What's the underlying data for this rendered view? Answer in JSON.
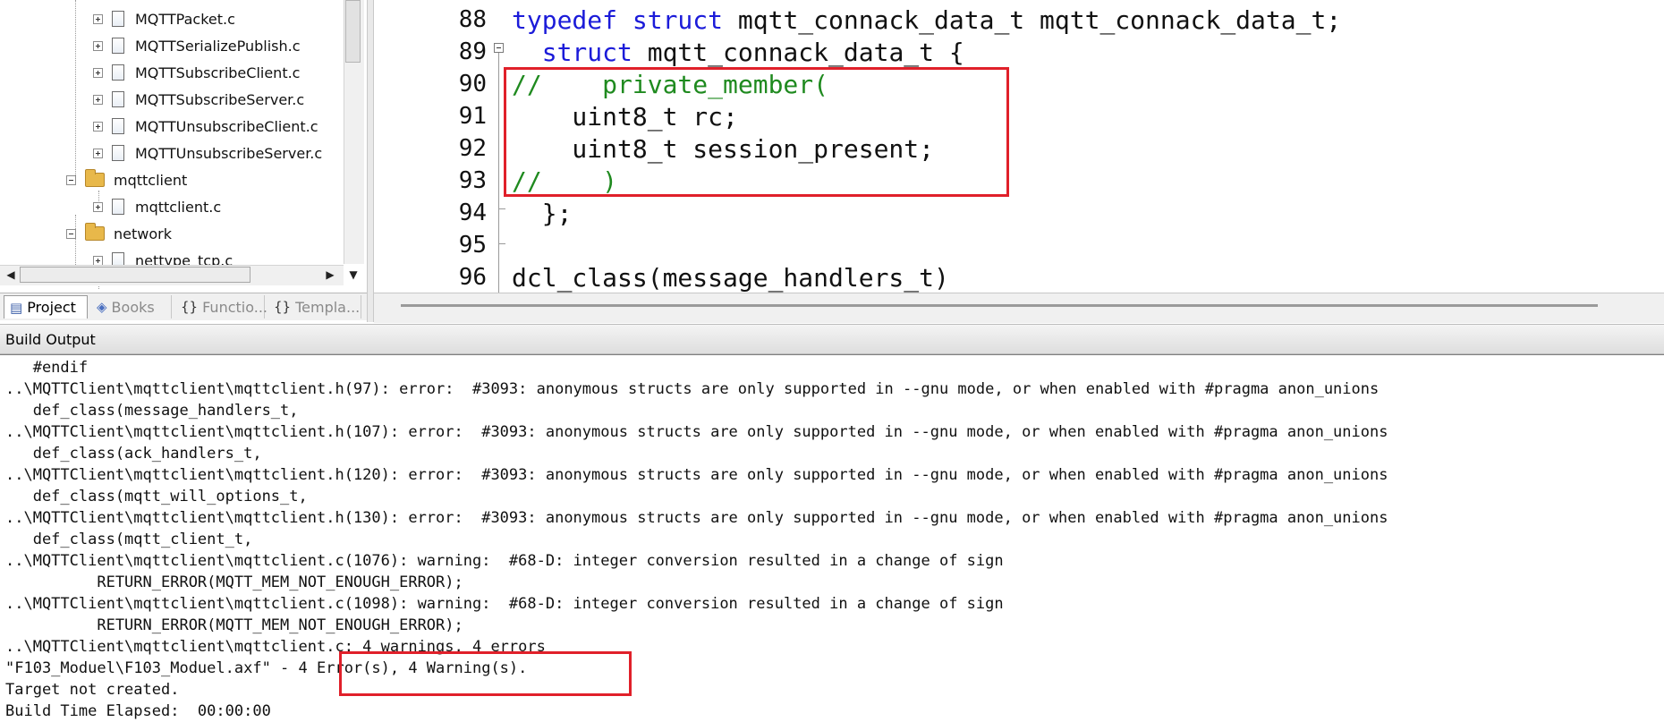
{
  "project_tree": {
    "items": [
      {
        "label": "MQTTPacket.c",
        "kind": "file"
      },
      {
        "label": "MQTTSerializePublish.c",
        "kind": "file"
      },
      {
        "label": "MQTTSubscribeClient.c",
        "kind": "file"
      },
      {
        "label": "MQTTSubscribeServer.c",
        "kind": "file"
      },
      {
        "label": "MQTTUnsubscribeClient.c",
        "kind": "file"
      },
      {
        "label": "MQTTUnsubscribeServer.c",
        "kind": "file"
      },
      {
        "label": "mqttclient",
        "kind": "folder"
      },
      {
        "label": "mqttclient.c",
        "kind": "file"
      },
      {
        "label": "network",
        "kind": "folder"
      },
      {
        "label": "nettype_tcp.c",
        "kind": "file"
      }
    ]
  },
  "tabs": [
    {
      "label": "Project",
      "icon": "project-icon",
      "active": true
    },
    {
      "label": "Books",
      "icon": "books-icon",
      "active": false
    },
    {
      "label": "Functio...",
      "icon": "functions-icon",
      "active": false
    },
    {
      "label": "Templa...",
      "icon": "templates-icon",
      "active": false
    }
  ],
  "editor": {
    "lines": [
      {
        "num": "88",
        "parts": [
          {
            "t": "typedef struct ",
            "c": "kw"
          },
          {
            "t": "mqtt_connack_data_t mqtt_connack_data_t;",
            "c": ""
          }
        ]
      },
      {
        "num": "89",
        "parts": [
          {
            "t": "  struct ",
            "c": "kw"
          },
          {
            "t": "mqtt_connack_data_t {",
            "c": ""
          }
        ]
      },
      {
        "num": "90",
        "parts": [
          {
            "t": "//    private_member(",
            "c": "cm"
          }
        ]
      },
      {
        "num": "91",
        "parts": [
          {
            "t": "    uint8_t rc;",
            "c": ""
          }
        ]
      },
      {
        "num": "92",
        "parts": [
          {
            "t": "    uint8_t session_present;",
            "c": ""
          }
        ]
      },
      {
        "num": "93",
        "parts": [
          {
            "t": "//    )",
            "c": "cm"
          }
        ]
      },
      {
        "num": "94",
        "parts": [
          {
            "t": "  };",
            "c": ""
          }
        ]
      },
      {
        "num": "95",
        "parts": [
          {
            "t": "",
            "c": ""
          }
        ]
      },
      {
        "num": "96",
        "parts": [
          {
            "t": "dcl_class(message_handlers_t)",
            "c": ""
          }
        ]
      }
    ]
  },
  "build_output": {
    "title": "Build Output",
    "lines": [
      "   #endif",
      "..\\MQTTClient\\mqttclient\\mqttclient.h(97): error:  #3093: anonymous structs are only supported in --gnu mode, or when enabled with #pragma anon_unions",
      "   def_class(message_handlers_t,",
      "..\\MQTTClient\\mqttclient\\mqttclient.h(107): error:  #3093: anonymous structs are only supported in --gnu mode, or when enabled with #pragma anon_unions",
      "   def_class(ack_handlers_t,",
      "..\\MQTTClient\\mqttclient\\mqttclient.h(120): error:  #3093: anonymous structs are only supported in --gnu mode, or when enabled with #pragma anon_unions",
      "   def_class(mqtt_will_options_t,",
      "..\\MQTTClient\\mqttclient\\mqttclient.h(130): error:  #3093: anonymous structs are only supported in --gnu mode, or when enabled with #pragma anon_unions",
      "   def_class(mqtt_client_t,",
      "..\\MQTTClient\\mqttclient\\mqttclient.c(1076): warning:  #68-D: integer conversion resulted in a change of sign",
      "          RETURN_ERROR(MQTT_MEM_NOT_ENOUGH_ERROR);",
      "..\\MQTTClient\\mqttclient\\mqttclient.c(1098): warning:  #68-D: integer conversion resulted in a change of sign",
      "          RETURN_ERROR(MQTT_MEM_NOT_ENOUGH_ERROR);",
      "..\\MQTTClient\\mqttclient\\mqttclient.c: 4 warnings, 4 errors",
      "\"F103_Moduel\\F103_Moduel.axf\" - 4 Error(s), 4 Warning(s).",
      "Target not created.",
      "Build Time Elapsed:  00:00:00"
    ]
  },
  "colors": {
    "keyword": "#1b1bd9",
    "comment": "#1f8a1f",
    "highlight": "#e0202a"
  }
}
